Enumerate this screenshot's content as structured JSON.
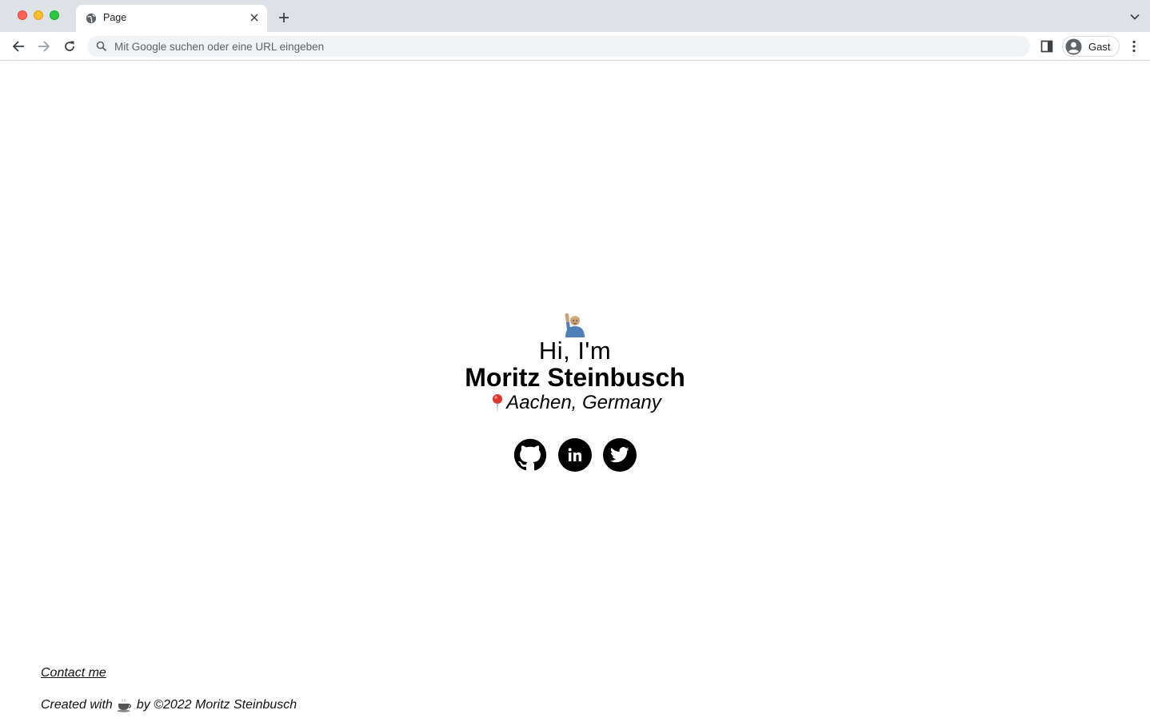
{
  "browser": {
    "tab": {
      "title": "Page",
      "favicon": "globe-icon"
    },
    "omnibox": {
      "placeholder": "Mit Google suchen oder eine URL eingeben",
      "value": ""
    },
    "profile": {
      "label": "Gast"
    },
    "icons": {
      "back": "arrow-left-icon",
      "forward": "arrow-right-icon",
      "reload": "reload-icon",
      "search": "search-icon",
      "side_panel": "side-panel-icon",
      "menu": "kebab-menu-icon",
      "new_tab": "plus-icon",
      "tab_list": "chevron-down-icon"
    }
  },
  "hero": {
    "emoji": "raising-hand-emoji",
    "greeting": "Hi, I'm",
    "name": "Moritz Steinbusch",
    "location_icon": "pin-emoji",
    "location": "Aachen, Germany"
  },
  "socials": [
    {
      "name": "github",
      "icon": "github-icon"
    },
    {
      "name": "linkedin",
      "icon": "linkedin-icon"
    },
    {
      "name": "twitter",
      "icon": "twitter-icon"
    }
  ],
  "footer": {
    "contact_label": "Contact me",
    "credits_prefix": "Created with",
    "credits_icon": "coffee-emoji",
    "credits_suffix": "by ©2022 Moritz Steinbusch"
  },
  "colors": {
    "tabstrip_bg": "#dee1e6",
    "omnibox_bg": "#f1f3f4",
    "text": "#000000",
    "social_bg": "#000000"
  }
}
